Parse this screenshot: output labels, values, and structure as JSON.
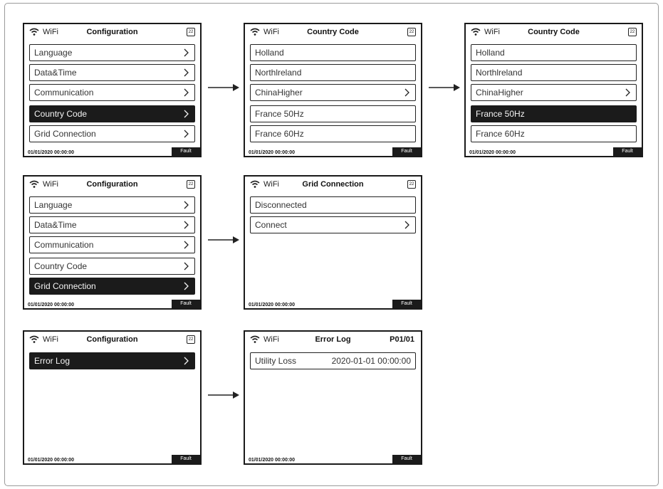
{
  "common": {
    "wifi_label": "WiFi",
    "badge": "22",
    "date": "01/01/2020  00:00:00",
    "fault": "Fault"
  },
  "screens": [
    {
      "title": "Configuration",
      "items": [
        {
          "label": "Language"
        },
        {
          "label": "Data&Time"
        },
        {
          "label": "Communication"
        },
        {
          "label": "Country Code",
          "selected": true
        },
        {
          "label": "Grid Connection"
        }
      ]
    },
    {
      "title": "Country Code",
      "items": [
        {
          "label": "Holland"
        },
        {
          "label": "Northlreland"
        },
        {
          "label": "ChinaHigher"
        },
        {
          "label": "France 50Hz"
        },
        {
          "label": "France 60Hz"
        }
      ]
    },
    {
      "title": "Country Code",
      "items": [
        {
          "label": "Holland"
        },
        {
          "label": "Northlreland"
        },
        {
          "label": "ChinaHigher"
        },
        {
          "label": "France 50Hz",
          "selected": true
        },
        {
          "label": "France 60Hz"
        }
      ]
    },
    {
      "title": "Configuration",
      "items": [
        {
          "label": "Language"
        },
        {
          "label": "Data&Time"
        },
        {
          "label": "Communication"
        },
        {
          "label": "Country Code"
        },
        {
          "label": "Grid Connection",
          "selected": true
        }
      ]
    },
    {
      "title": "Grid Connection",
      "items": [
        {
          "label": "Disconnected"
        },
        {
          "label": "Connect"
        }
      ]
    },
    {
      "title": "Configuration",
      "items": [
        {
          "label": "Error Log",
          "selected": true
        }
      ]
    },
    {
      "title": "Error Log",
      "page": "P01/01",
      "items": [
        {
          "label": "Utility Loss",
          "value": "2020-01-01  00:00:00"
        }
      ]
    }
  ]
}
